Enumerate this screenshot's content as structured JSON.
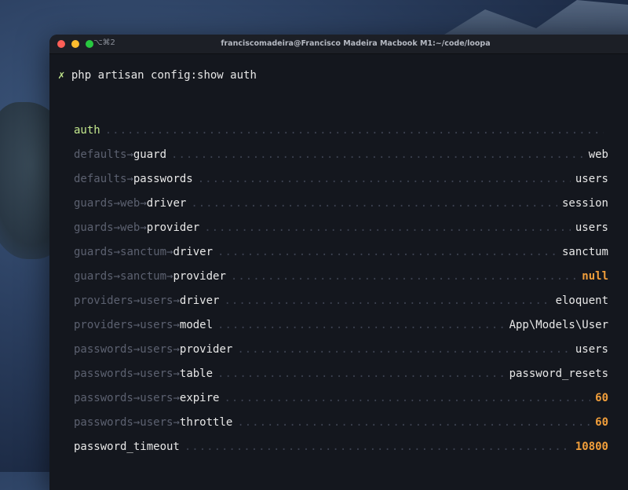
{
  "window": {
    "title": "franciscomadeira@Francisco Madeira Macbook M1:~/code/loopa",
    "shortcut": "⌥⌘2"
  },
  "terminal": {
    "prompt_symbol": "✗",
    "command": "php artisan config:show auth",
    "header": "auth",
    "separator": "→",
    "rows": [
      {
        "path": [
          "defaults"
        ],
        "key": "guard",
        "value": "web",
        "type": "str"
      },
      {
        "path": [
          "defaults"
        ],
        "key": "passwords",
        "value": "users",
        "type": "str"
      },
      {
        "path": [
          "guards",
          "web"
        ],
        "key": "driver",
        "value": "session",
        "type": "str"
      },
      {
        "path": [
          "guards",
          "web"
        ],
        "key": "provider",
        "value": "users",
        "type": "str"
      },
      {
        "path": [
          "guards",
          "sanctum"
        ],
        "key": "driver",
        "value": "sanctum",
        "type": "str"
      },
      {
        "path": [
          "guards",
          "sanctum"
        ],
        "key": "provider",
        "value": "null",
        "type": "null"
      },
      {
        "path": [
          "providers",
          "users"
        ],
        "key": "driver",
        "value": "eloquent",
        "type": "str"
      },
      {
        "path": [
          "providers",
          "users"
        ],
        "key": "model",
        "value": "App\\Models\\User",
        "type": "str"
      },
      {
        "path": [
          "passwords",
          "users"
        ],
        "key": "provider",
        "value": "users",
        "type": "str"
      },
      {
        "path": [
          "passwords",
          "users"
        ],
        "key": "table",
        "value": "password_resets",
        "type": "str"
      },
      {
        "path": [
          "passwords",
          "users"
        ],
        "key": "expire",
        "value": "60",
        "type": "num"
      },
      {
        "path": [
          "passwords",
          "users"
        ],
        "key": "throttle",
        "value": "60",
        "type": "num"
      },
      {
        "path": [],
        "key": "password_timeout",
        "value": "10800",
        "type": "num"
      }
    ]
  }
}
